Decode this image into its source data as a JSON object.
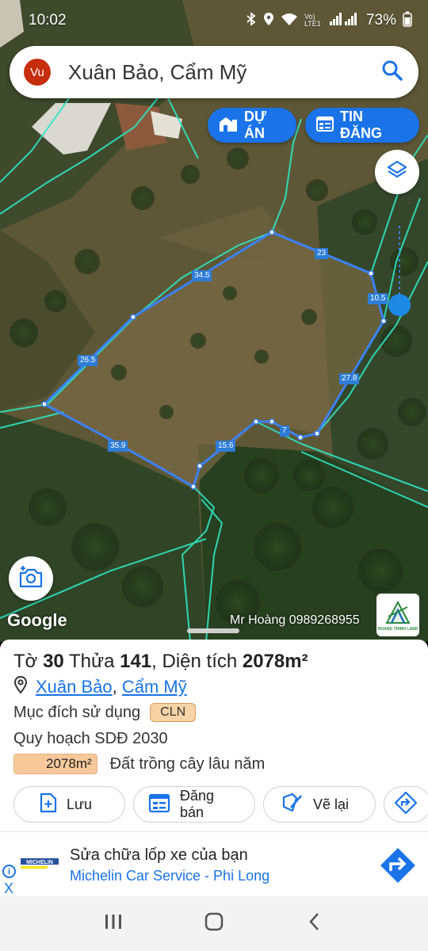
{
  "status_bar": {
    "time": "10:02",
    "battery": "73%",
    "network": "Vo) LTE1"
  },
  "search": {
    "avatar": "Vu",
    "title": "Xuân Bảo, Cẩm Mỹ",
    "icon": "search-icon"
  },
  "pills": {
    "du_an": "DỰ ÁN",
    "tin_dang": "TIN ĐĂNG"
  },
  "map": {
    "google": "Google",
    "watermark": "Mr Hoàng 0989268955",
    "brand": "HOANG THINH LAND",
    "segments": [
      "34.5",
      "23",
      "10.5",
      "27.8",
      "7",
      "15.6",
      "35.9",
      "26.5"
    ]
  },
  "parcel": {
    "to_label": "Tờ",
    "to_value": "30",
    "thua_label": "Thửa",
    "thua_value": "141",
    "area_label": "Diện tích",
    "area_value": "2078m²",
    "ward": "Xuân Bảo",
    "district": "Cẩm Mỹ",
    "purpose_label": "Mục đích sử dụng",
    "purpose_code": "CLN",
    "plan_label": "Quy hoạch SDĐ 2030",
    "plan_area": "2078m²",
    "plan_type": "Đất trồng cây lâu năm"
  },
  "actions": {
    "luu": "Lưu",
    "dang_ban": "Đăng bán",
    "ve_lai": "Vẽ lại"
  },
  "ad": {
    "title": "Sửa chữa lốp xe của bạn",
    "subtitle": "Michelin Car Service - Phi Long",
    "brand": "MICHELIN",
    "close": "X"
  },
  "colors": {
    "accent": "#1a73e8",
    "boundary": "#3b82f6",
    "cadastral": "#2ee6c4"
  }
}
